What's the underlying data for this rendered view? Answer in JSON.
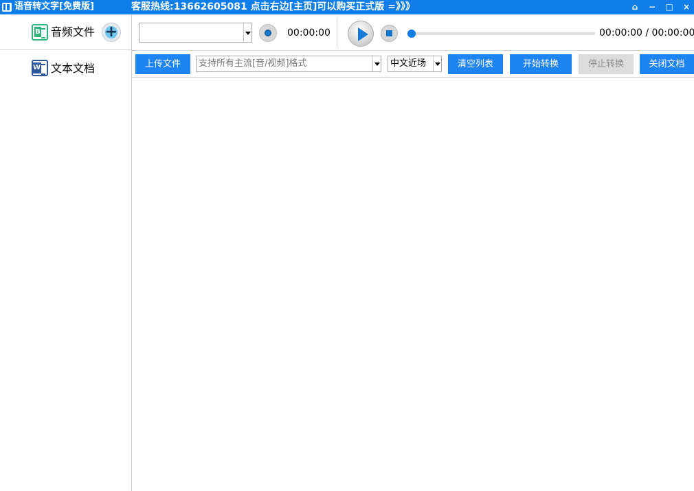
{
  "window": {
    "title": "语音转文字[免费版]",
    "hotline": "客服热线:13662605081  点击右边[主页]可以购买正式版 =》》》",
    "controls": {
      "home_glyph": "⌂",
      "minimize_glyph": "−",
      "maximize_glyph": "□",
      "close_glyph": "×"
    }
  },
  "sidebar": {
    "audio_label": "音频文件",
    "text_label": "文本文档",
    "add_icon": "plus-icon"
  },
  "player": {
    "file_select_value": "",
    "current_time": "00:00:00",
    "progress_fraction": 0,
    "time_display": "00:00:00 / 00:00:00"
  },
  "toolbar": {
    "upload_label": "上传文件",
    "format_placeholder": "支持所有主流[音/视频]格式",
    "language_value": "中文近场",
    "clear_label": "清空列表",
    "start_label": "开始转换",
    "stop_label": "停止转换",
    "close_label": "关闭文档"
  },
  "colors": {
    "accent": "#0f7ee8",
    "button_blue": "#1e84f2",
    "disabled_gray": "#dcdcdc",
    "audio_green": "#2db57c",
    "word_blue": "#2b579a"
  }
}
